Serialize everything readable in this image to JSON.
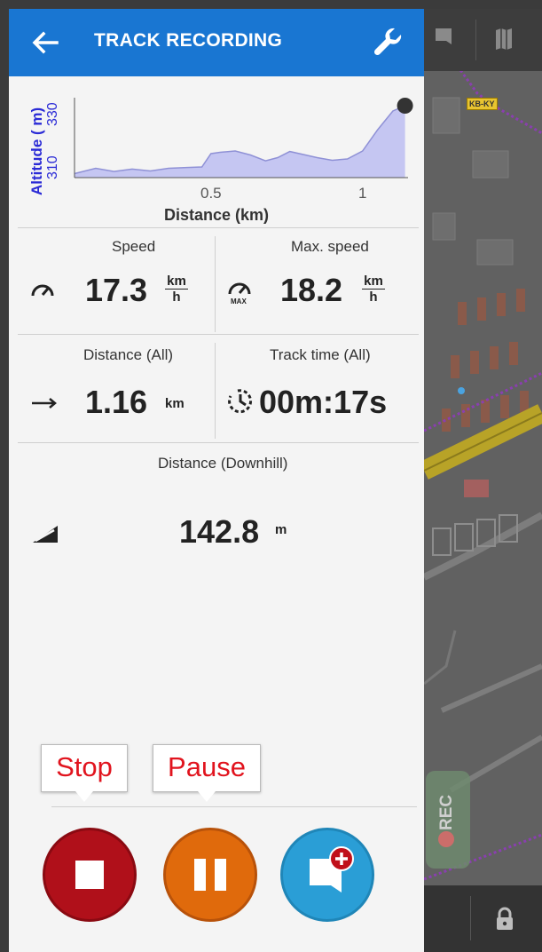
{
  "header": {
    "title": "TRACK RECORDING",
    "back_icon": "arrow-left-icon",
    "settings_icon": "wrench-icon"
  },
  "chart_data": {
    "type": "area",
    "xlabel": "Distance (km)",
    "ylabel": "Altitude ( m)",
    "x_ticks": [
      "0.5",
      "1"
    ],
    "y_ticks": [
      "310",
      "330"
    ],
    "xlim": [
      0.05,
      1.15
    ],
    "ylim": [
      306,
      336
    ],
    "x": [
      0.05,
      0.12,
      0.18,
      0.24,
      0.3,
      0.36,
      0.42,
      0.47,
      0.5,
      0.53,
      0.58,
      0.63,
      0.68,
      0.72,
      0.76,
      0.8,
      0.85,
      0.9,
      0.95,
      1.0,
      1.05,
      1.1,
      1.14
    ],
    "y": [
      307.5,
      309.5,
      308.3,
      309.2,
      308.5,
      309.5,
      309.8,
      310.0,
      315.0,
      315.5,
      316.0,
      314.5,
      312.3,
      313.5,
      315.8,
      314.8,
      313.5,
      312.5,
      313.0,
      316.0,
      324.0,
      331.0,
      333.0
    ],
    "fill": "#c5c6f2",
    "line": "#8f91d6",
    "label_color": "#2b2bd6"
  },
  "stats": {
    "speed": {
      "label": "Speed",
      "value": "17.3",
      "unit_top": "km",
      "unit_bottom": "h",
      "icon": "speedometer-icon"
    },
    "max_speed": {
      "label": "Max. speed",
      "value": "18.2",
      "unit_top": "km",
      "unit_bottom": "h",
      "icon": "max-speedometer-icon",
      "icon_text": "MAX"
    },
    "distance_all": {
      "label": "Distance (All)",
      "value": "1.16",
      "unit": "km",
      "icon": "arrow-right-icon"
    },
    "track_time_all": {
      "label": "Track time (All)",
      "value": "00m:17s",
      "icon": "timer-icon"
    },
    "distance_downhill": {
      "label": "Distance (Downhill)",
      "value": "142.8",
      "unit": "m",
      "icon": "downhill-icon"
    }
  },
  "controls": {
    "stop_tooltip": "Stop",
    "pause_tooltip": "Pause",
    "stop_icon": "stop-icon",
    "pause_icon": "pause-icon",
    "add_note_icon": "add-comment-icon"
  },
  "map": {
    "rec_label": "REC",
    "sign_label": "KB-KY",
    "toolbar_icons": [
      "map-layers-icon",
      "map-icon"
    ],
    "lock_icon": "lock-icon"
  },
  "colors": {
    "header": "#1976d2",
    "stop": "#b0101a",
    "pause": "#e06a0c",
    "note": "#2a9ed6",
    "tooltip_text": "#e1141e"
  }
}
